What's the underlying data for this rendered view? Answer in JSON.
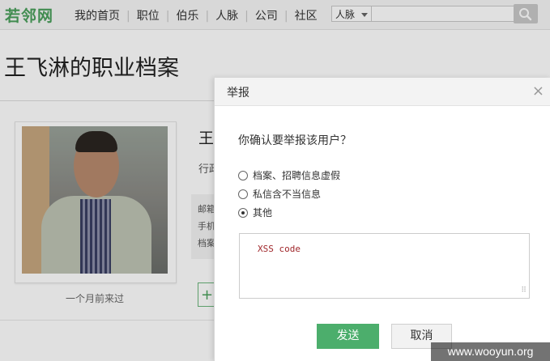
{
  "site": {
    "logo": "若邻网"
  },
  "nav": {
    "items": [
      "我的首页",
      "职位",
      "伯乐",
      "人脉",
      "公司",
      "社区"
    ],
    "separator": "|"
  },
  "search": {
    "selected_option": "人脉",
    "placeholder": ""
  },
  "profile": {
    "page_title": "王飞淋的职业档案",
    "name_visible": "王",
    "industry_visible": "行政",
    "contact_labels": [
      "邮箱",
      "手机",
      "档案"
    ],
    "last_seen": "一个月前来过",
    "add_button_visible": "+"
  },
  "report_dialog": {
    "title": "举报",
    "close_symbol": "×",
    "question": "你确认要举报该用户？",
    "options": [
      {
        "label": "档案、招聘信息虚假",
        "checked": false
      },
      {
        "label": "私信含不当信息",
        "checked": false
      },
      {
        "label": "其他",
        "checked": true
      }
    ],
    "textarea_value": "XSS code",
    "textarea_grip": "⠿",
    "send_label": "发送",
    "cancel_label": "取消"
  },
  "watermark": "www.wooyun.org",
  "colors": {
    "brand": "#4aa05c",
    "send_button": "#4cae6c",
    "xss_text": "#a0272b"
  }
}
